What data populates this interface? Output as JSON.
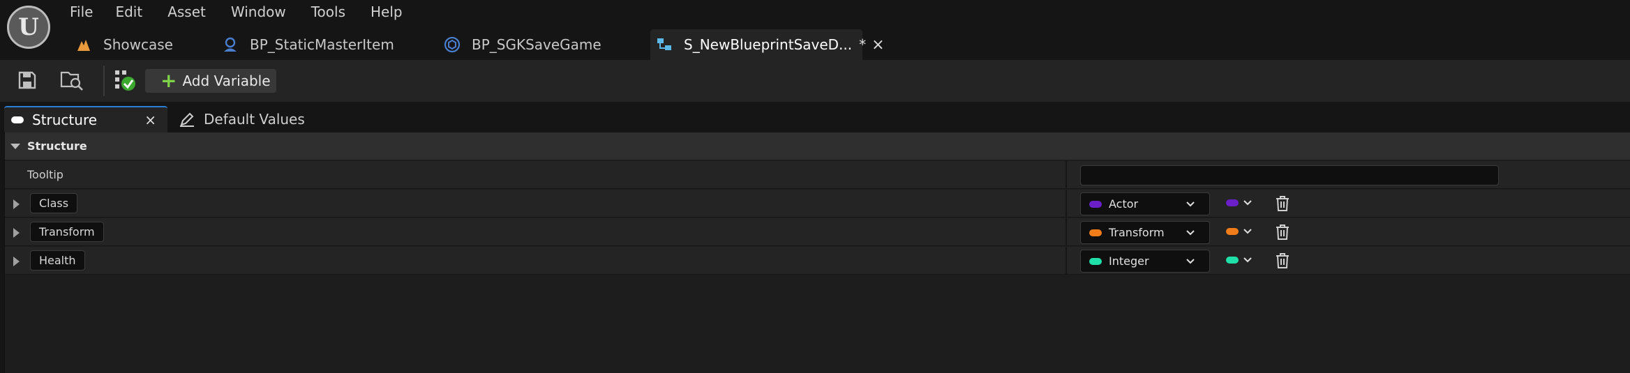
{
  "app": {
    "logo_letter": "U"
  },
  "menu": [
    "File",
    "Edit",
    "Asset",
    "Window",
    "Tools",
    "Help"
  ],
  "doc_tabs": [
    {
      "label": "Showcase",
      "icon": "level-icon",
      "icon_color": "#e89a3c"
    },
    {
      "label": "BP_StaticMasterItem",
      "icon": "blueprint-actor-icon",
      "icon_color": "#4a7fd0"
    },
    {
      "label": "BP_SGKSaveGame",
      "icon": "blueprint-object-icon",
      "icon_color": "#4a7fd0"
    },
    {
      "label": "S_NewBlueprintSaveD...",
      "icon": "struct-icon",
      "icon_color": "#5bb8e8",
      "dirty": "*",
      "close": "×"
    }
  ],
  "toolbar": {
    "save_icon": "save-icon",
    "browse_icon": "browse-icon",
    "compile_icon": "compile-status-icon",
    "add_variable_label": "Add Variable"
  },
  "panel_tabs": {
    "structure_label": "Structure",
    "close": "×",
    "defaults_label": "Default Values"
  },
  "category": {
    "label": "Structure"
  },
  "tooltip_row": {
    "label": "Tooltip",
    "value": ""
  },
  "variables": [
    {
      "name": "Class",
      "type": "Actor",
      "color": "#6a1fc8"
    },
    {
      "name": "Transform",
      "type": "Transform",
      "color": "#f07d1a"
    },
    {
      "name": "Health",
      "type": "Integer",
      "color": "#1fe0a8"
    }
  ],
  "colors": {
    "accent": "#2a7fd6",
    "add_green": "#7fd34a"
  }
}
